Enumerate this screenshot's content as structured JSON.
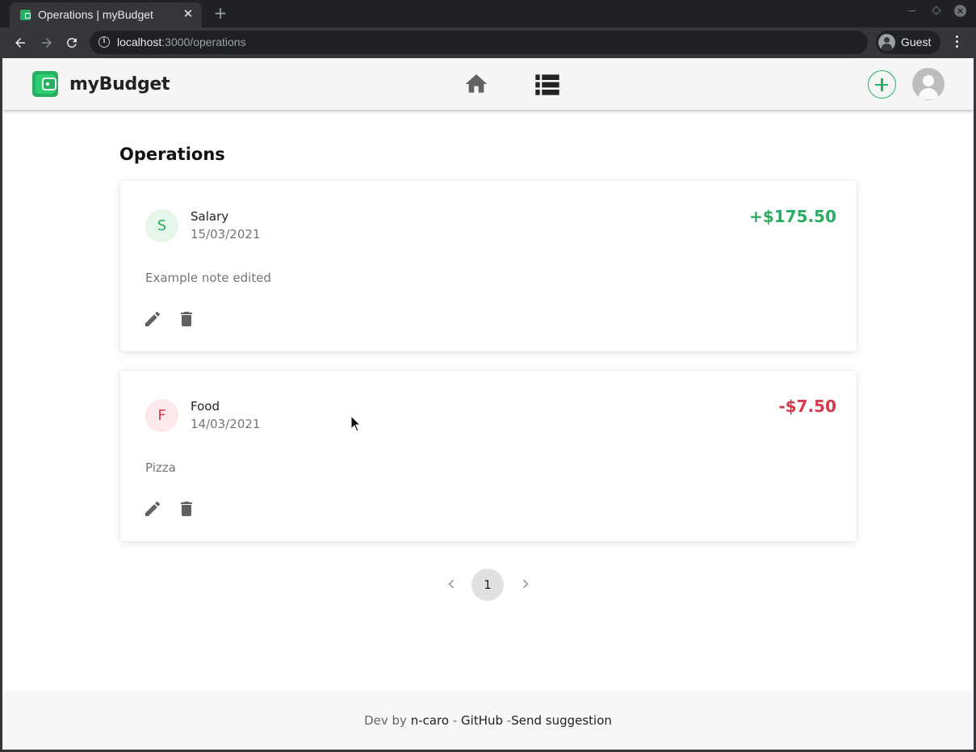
{
  "browser": {
    "tab_title": "Operations | myBudget",
    "url_host": "localhost",
    "url_path": ":3000/operations",
    "profile_label": "Guest"
  },
  "app": {
    "logo_text": "myBudget",
    "page_title": "Operations",
    "brand_color": "#27ae60",
    "income_color": "#27ae60",
    "expense_color": "#d63a4a"
  },
  "operations": [
    {
      "letter": "S",
      "category": "Salary",
      "date": "15/03/2021",
      "amount": "+$175.50",
      "note": "Example note edited",
      "kind": "income"
    },
    {
      "letter": "F",
      "category": "Food",
      "date": "14/03/2021",
      "amount": "-$7.50",
      "note": "Pizza",
      "kind": "expense"
    }
  ],
  "pagination": {
    "current_page": "1"
  },
  "footer": {
    "prefix": "Dev by ",
    "author": "n-caro",
    "sep1": " - ",
    "github": "GitHub",
    "sep2": " -",
    "suggestion": "Send suggestion"
  },
  "icons": {
    "home": "home-icon",
    "list": "list-icon",
    "add": "plus-icon",
    "avatar": "user-avatar-icon",
    "edit": "pencil-icon",
    "delete": "trash-icon",
    "prev": "chevron-left-icon",
    "next": "chevron-right-icon"
  }
}
